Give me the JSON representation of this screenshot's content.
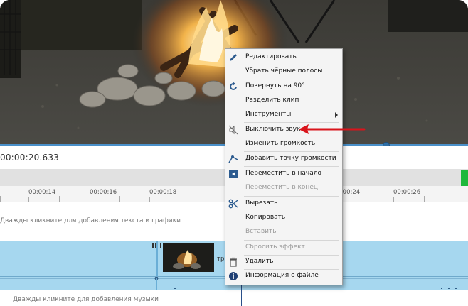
{
  "timecode": "00:00:20.633",
  "ruler": {
    "labels": [
      "00:00:14",
      "00:00:16",
      "00:00:18",
      "00:00:24",
      "00:00:26"
    ]
  },
  "tracks": {
    "text_hint": "Дважды кликните для добавления текста и графики",
    "music_hint": "Дважды кликните для добавления музыки",
    "clip_title_fragment": "тр"
  },
  "menu": {
    "items": [
      {
        "label": "Редактировать",
        "icon": "pencil-icon",
        "disabled": false
      },
      {
        "label": "Убрать чёрные полосы",
        "icon": "",
        "disabled": false
      },
      {
        "label": "Повернуть на 90°",
        "icon": "rotate-icon",
        "disabled": false
      },
      {
        "label": "Разделить клип",
        "icon": "",
        "disabled": false
      },
      {
        "label": "Инструменты",
        "icon": "",
        "disabled": false,
        "submenu": true
      },
      {
        "label": "Выключить звук",
        "icon": "mute-icon",
        "disabled": false
      },
      {
        "label": "Изменить громкость",
        "icon": "",
        "disabled": false
      },
      {
        "label": "Добавить точку громкости",
        "icon": "volume-point-icon",
        "disabled": false
      },
      {
        "label": "Переместить в начало",
        "icon": "move-start-icon",
        "disabled": false
      },
      {
        "label": "Переместить в конец",
        "icon": "",
        "disabled": true
      },
      {
        "label": "Вырезать",
        "icon": "scissors-icon",
        "disabled": false
      },
      {
        "label": "Копировать",
        "icon": "",
        "disabled": false
      },
      {
        "label": "Вставить",
        "icon": "",
        "disabled": true
      },
      {
        "label": "Сбросить эффект",
        "icon": "",
        "disabled": true
      },
      {
        "label": "Удалить",
        "icon": "trash-icon",
        "disabled": false
      },
      {
        "label": "Информация о файле",
        "icon": "info-icon",
        "disabled": false
      }
    ]
  },
  "colors": {
    "accent_blue": "#4a90c9",
    "track_blue": "#a6d7ef",
    "marker_green": "#1fb83b",
    "annotation_red": "#d9141b"
  }
}
